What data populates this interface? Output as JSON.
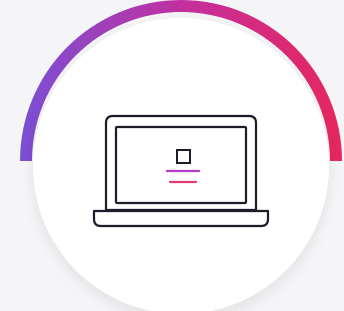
{
  "colors": {
    "background": "#f5f5f8",
    "circle": "#ffffff",
    "arc_start": "#7b4fd6",
    "arc_mid": "#c42f9c",
    "arc_end": "#e8265e",
    "outline": "#1c1c2a",
    "accent_line_1": "#b23cc8",
    "accent_line_2": "#e23a77"
  },
  "icon": {
    "name": "laptop-icon",
    "screen_symbol": "document-icon"
  }
}
